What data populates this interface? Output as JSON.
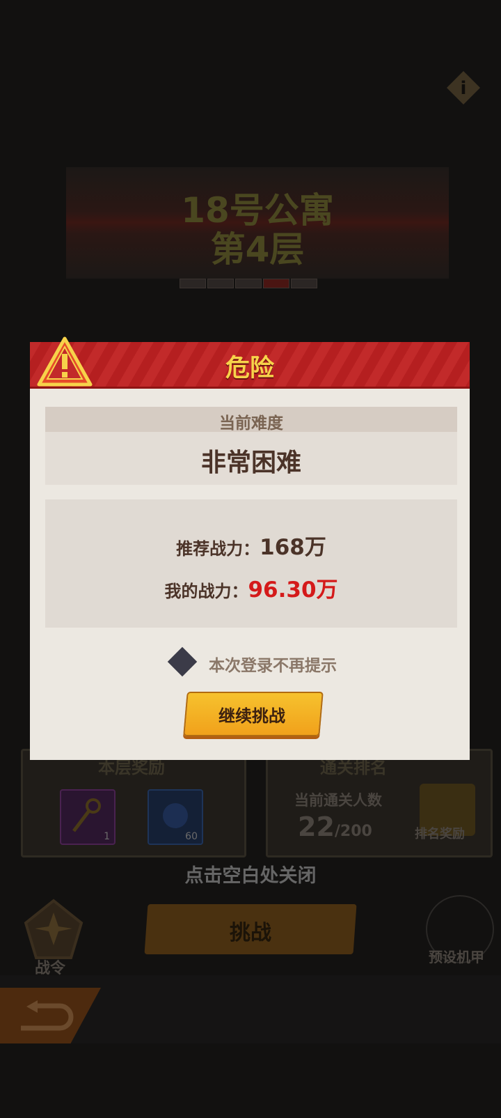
{
  "background": {
    "floor_title_line1": "18号公寓",
    "floor_title_line2": "第4层",
    "reward_panel": {
      "title": "本层奖励",
      "items": [
        {
          "icon": "key-icon",
          "count": "1"
        },
        {
          "icon": "blue-orb-icon",
          "count": "60"
        }
      ]
    },
    "rank_panel": {
      "title": "通关排名",
      "label": "当前通关人数",
      "count": "22",
      "total": "/200",
      "chest_label": "排名奖励"
    },
    "close_hint": "点击空白处关闭",
    "battlepass_label": "战令",
    "challenge_label": "挑战",
    "mecha_label": "预设机甲"
  },
  "dialog": {
    "title": "危险",
    "difficulty_label": "当前难度",
    "difficulty_value": "非常困难",
    "recommended_label": "推荐战力：",
    "recommended_value": "168万",
    "my_label": "我的战力：",
    "my_value": "96.30万",
    "checkbox_label": "本次登录不再提示",
    "continue_label": "继续挑战"
  },
  "colors": {
    "header_red": "#c22a2a",
    "title_yellow": "#f7d34a",
    "warning_red": "#d41a1a",
    "button_orange": "#f6c22e"
  }
}
